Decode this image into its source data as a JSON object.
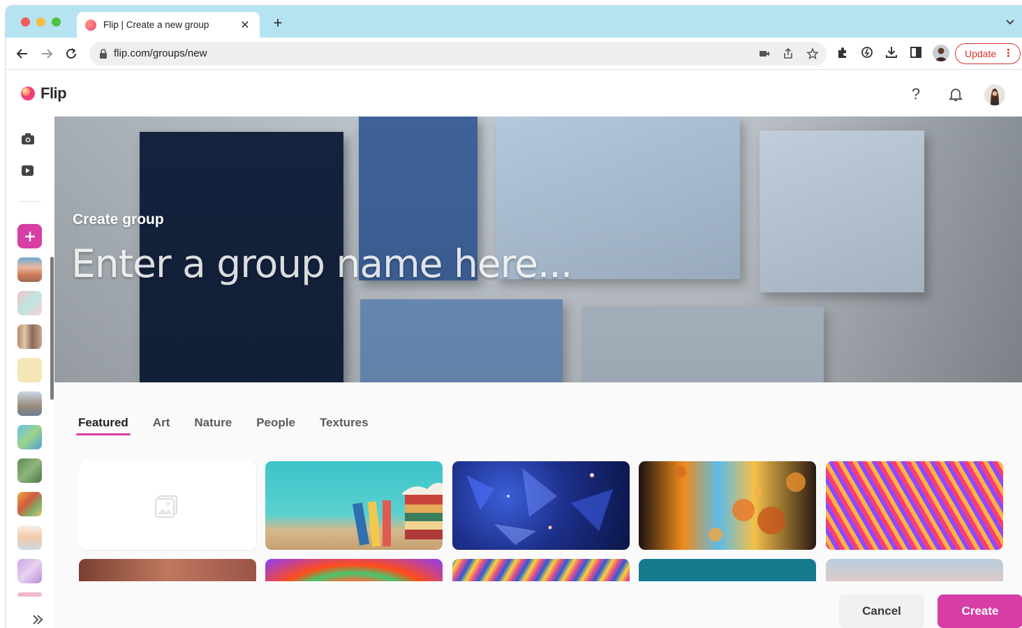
{
  "browser": {
    "tab_title": "Flip | Create a new group",
    "url": "flip.com/groups/new",
    "update_label": "Update",
    "new_tab_symbol": "+",
    "close_symbol": "✕"
  },
  "app": {
    "brand_name": "Flip",
    "help_symbol": "?"
  },
  "cover": {
    "label": "Create group",
    "name_placeholder": "Enter a group name here..."
  },
  "picker": {
    "tabs": [
      "Featured",
      "Art",
      "Nature",
      "People",
      "Textures"
    ],
    "active_tab": "Featured"
  },
  "actions": {
    "cancel_label": "Cancel",
    "create_label": "Create"
  },
  "colors": {
    "accent": "#d63ea6",
    "tab_strip": "#b6e3f2",
    "update_red": "#d93025"
  },
  "icons": [
    "back-arrow-icon",
    "forward-arrow-icon",
    "reload-icon",
    "lock-icon",
    "camera-icon",
    "share-icon",
    "star-icon",
    "puzzle-icon",
    "download-icon",
    "sidebar-toggle-icon",
    "help-icon",
    "bell-icon",
    "camera-icon",
    "video-icon",
    "plus-icon",
    "expand-icon",
    "image-placeholder-icon"
  ]
}
